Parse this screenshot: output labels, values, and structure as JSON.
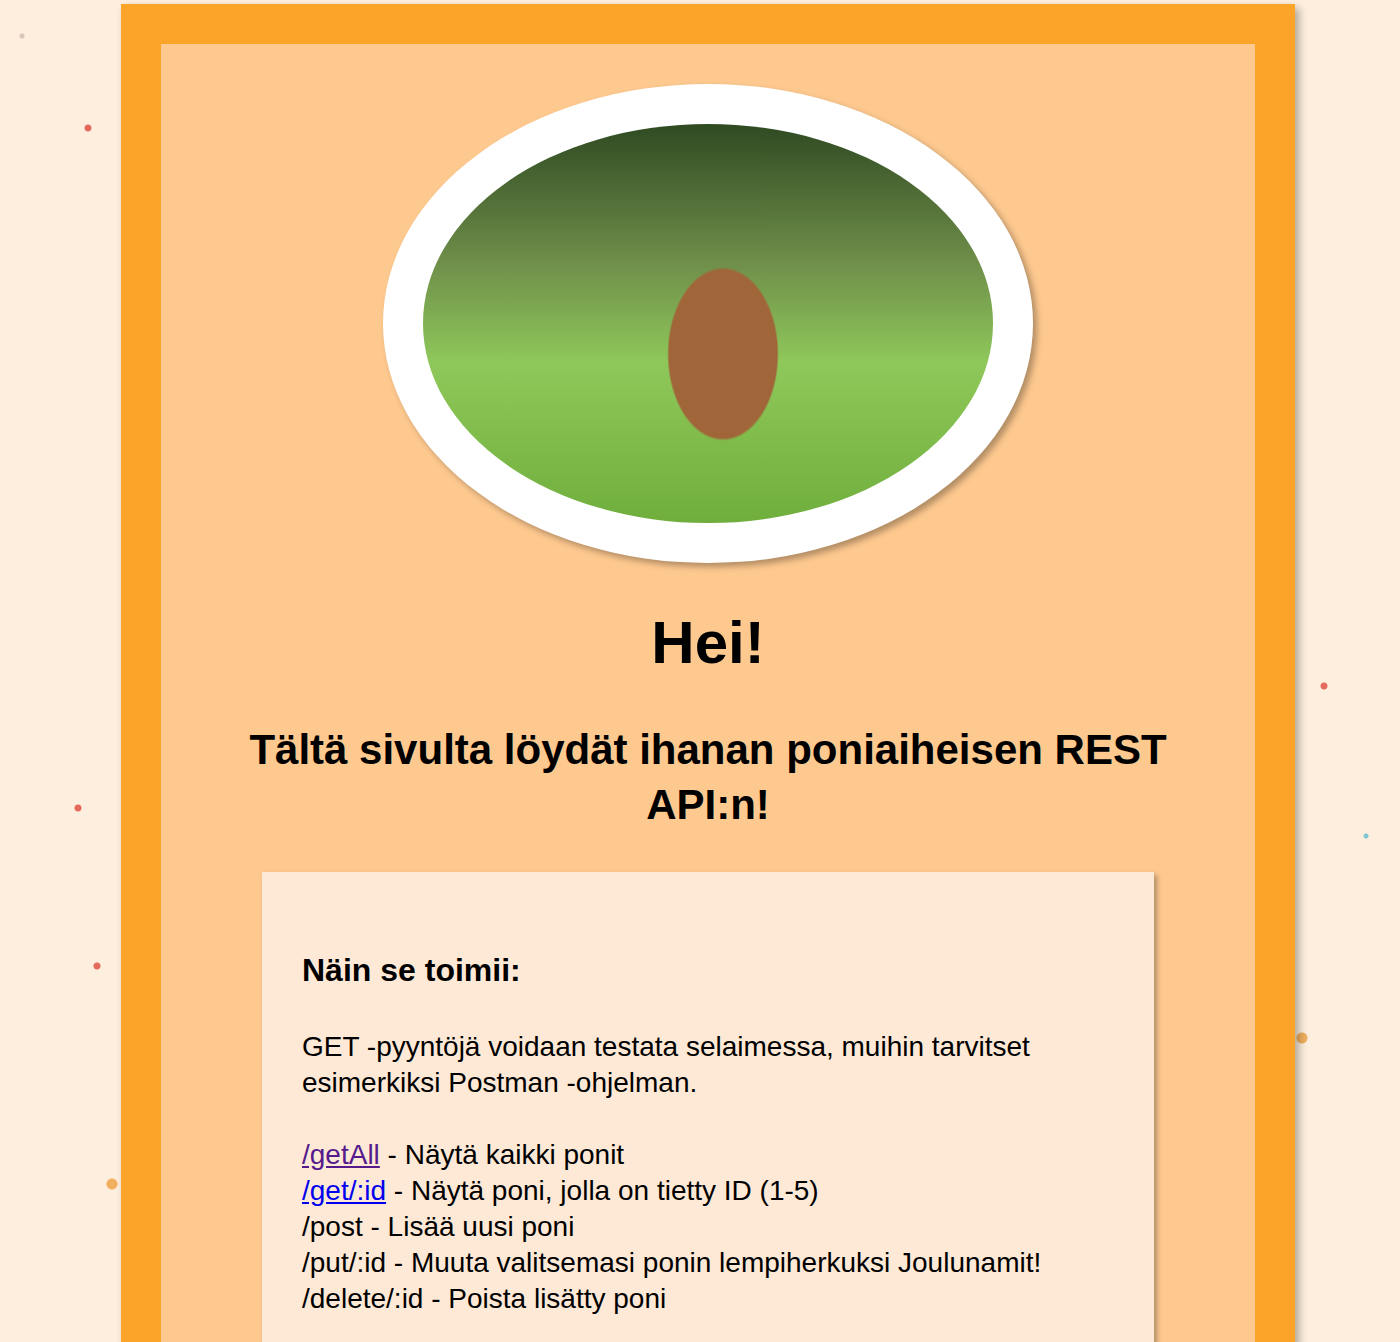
{
  "page": {
    "greeting": "Hei!",
    "subtitle": "Tältä sivulta löydät ihanan poniaiheisen REST API:n!"
  },
  "photo": {
    "alt": "pony-photo"
  },
  "info": {
    "heading": "Näin se toimii:",
    "intro": "GET -pyyntöjä voidaan testata selaimessa, muihin tarvitset esimerkiksi Postman -ohjelman.",
    "endpoints": [
      {
        "path": "/getAll",
        "description": " - Näytä kaikki ponit",
        "link": true,
        "visited": true
      },
      {
        "path": "/get/:id",
        "description": " - Näytä poni, jolla on tietty ID (1-5)",
        "link": true,
        "visited": false
      },
      {
        "path": "/post",
        "description": " - Lisää uusi poni",
        "link": false,
        "visited": false
      },
      {
        "path": "/put/:id",
        "description": " - Muuta valitsemasi ponin lempiherkuksi Joulunamit!",
        "link": false,
        "visited": false
      },
      {
        "path": "/delete/:id",
        "description": " - Poista lisätty poni",
        "link": false,
        "visited": false
      }
    ]
  }
}
